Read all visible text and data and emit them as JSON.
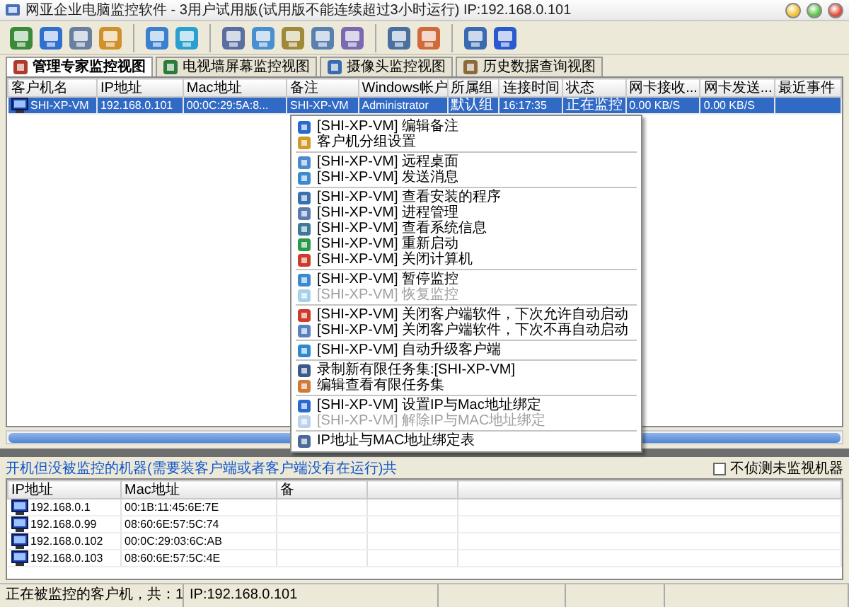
{
  "window": {
    "title": "网亚企业电脑监控软件 - 3用户试用版(试用版不能连续超过3小时运行) IP:192.168.0.101"
  },
  "tabs": [
    {
      "label": "管理专家监控视图",
      "selected": true
    },
    {
      "label": "电视墙屏幕监控视图",
      "selected": false
    },
    {
      "label": "摄像头监控视图",
      "selected": false
    },
    {
      "label": "历史数据查询视图",
      "selected": false
    }
  ],
  "clients_table": {
    "columns": [
      "客户机名",
      "IP地址",
      "Mac地址",
      "备注",
      "Windows帐户",
      "所属组",
      "连接时间",
      "状态",
      "网卡接收...",
      "网卡发送...",
      "最近事件"
    ],
    "rows": [
      {
        "selected": true,
        "cells": [
          "SHI-XP-VM",
          "192.168.0.101",
          "00:0C:29:5A:8...",
          "SHI-XP-VM",
          "Administrator",
          "默认组",
          "16:17:35",
          "正在监控",
          "0.00 KB/S",
          "0.00 KB/S"
        ]
      }
    ]
  },
  "context_menu": {
    "items": [
      {
        "kind": "item",
        "label": "[SHI-XP-VM] 编辑备注",
        "disabled": false
      },
      {
        "kind": "item",
        "label": "客户机分组设置",
        "disabled": false
      },
      {
        "kind": "separator"
      },
      {
        "kind": "item",
        "label": "[SHI-XP-VM] 远程桌面",
        "disabled": false
      },
      {
        "kind": "item",
        "label": "[SHI-XP-VM] 发送消息",
        "disabled": false
      },
      {
        "kind": "separator"
      },
      {
        "kind": "item",
        "label": "[SHI-XP-VM] 查看安装的程序",
        "disabled": false
      },
      {
        "kind": "item",
        "label": "[SHI-XP-VM] 进程管理",
        "disabled": false
      },
      {
        "kind": "item",
        "label": "[SHI-XP-VM] 查看系统信息",
        "disabled": false
      },
      {
        "kind": "item",
        "label": "[SHI-XP-VM] 重新启动",
        "disabled": false
      },
      {
        "kind": "item",
        "label": "[SHI-XP-VM] 关闭计算机",
        "disabled": false
      },
      {
        "kind": "separator"
      },
      {
        "kind": "item",
        "label": "[SHI-XP-VM] 暂停监控",
        "disabled": false
      },
      {
        "kind": "item",
        "label": "[SHI-XP-VM] 恢复监控",
        "disabled": true
      },
      {
        "kind": "separator"
      },
      {
        "kind": "item",
        "label": "[SHI-XP-VM] 关闭客户端软件，下次允许自动启动",
        "disabled": false
      },
      {
        "kind": "item",
        "label": "[SHI-XP-VM] 关闭客户端软件，下次不再自动启动",
        "disabled": false
      },
      {
        "kind": "separator"
      },
      {
        "kind": "item",
        "label": "[SHI-XP-VM] 自动升级客户端",
        "disabled": false
      },
      {
        "kind": "separator"
      },
      {
        "kind": "item",
        "label": "录制新有限任务集:[SHI-XP-VM]",
        "disabled": false
      },
      {
        "kind": "item",
        "label": "编辑查看有限任务集",
        "disabled": false
      },
      {
        "kind": "separator"
      },
      {
        "kind": "item",
        "label": "[SHI-XP-VM] 设置IP与Mac地址绑定",
        "disabled": false
      },
      {
        "kind": "item",
        "label": "[SHI-XP-VM] 解除IP与MAC地址绑定",
        "disabled": true
      },
      {
        "kind": "separator"
      },
      {
        "kind": "item",
        "label": "IP地址与MAC地址绑定表",
        "disabled": false
      }
    ]
  },
  "unmonitored_panel": {
    "title": "开机但没被监控的机器(需要装客户端或者客户端没有在运行)共",
    "checkbox": {
      "label": "不侦测未监视机器",
      "checked": false
    },
    "columns": [
      "IP地址",
      "Mac地址",
      "备"
    ],
    "rows": [
      [
        "192.168.0.1",
        "00:1B:11:45:6E:7E"
      ],
      [
        "192.168.0.99",
        "08:60:6E:57:5C:74"
      ],
      [
        "192.168.0.102",
        "00:0C:29:03:6C:AB"
      ],
      [
        "192.168.0.103",
        "08:60:6E:57:5C:4E"
      ]
    ]
  },
  "status_bar": [
    "正在被监控的客户机，共：1",
    "IP:192.168.0.101"
  ]
}
